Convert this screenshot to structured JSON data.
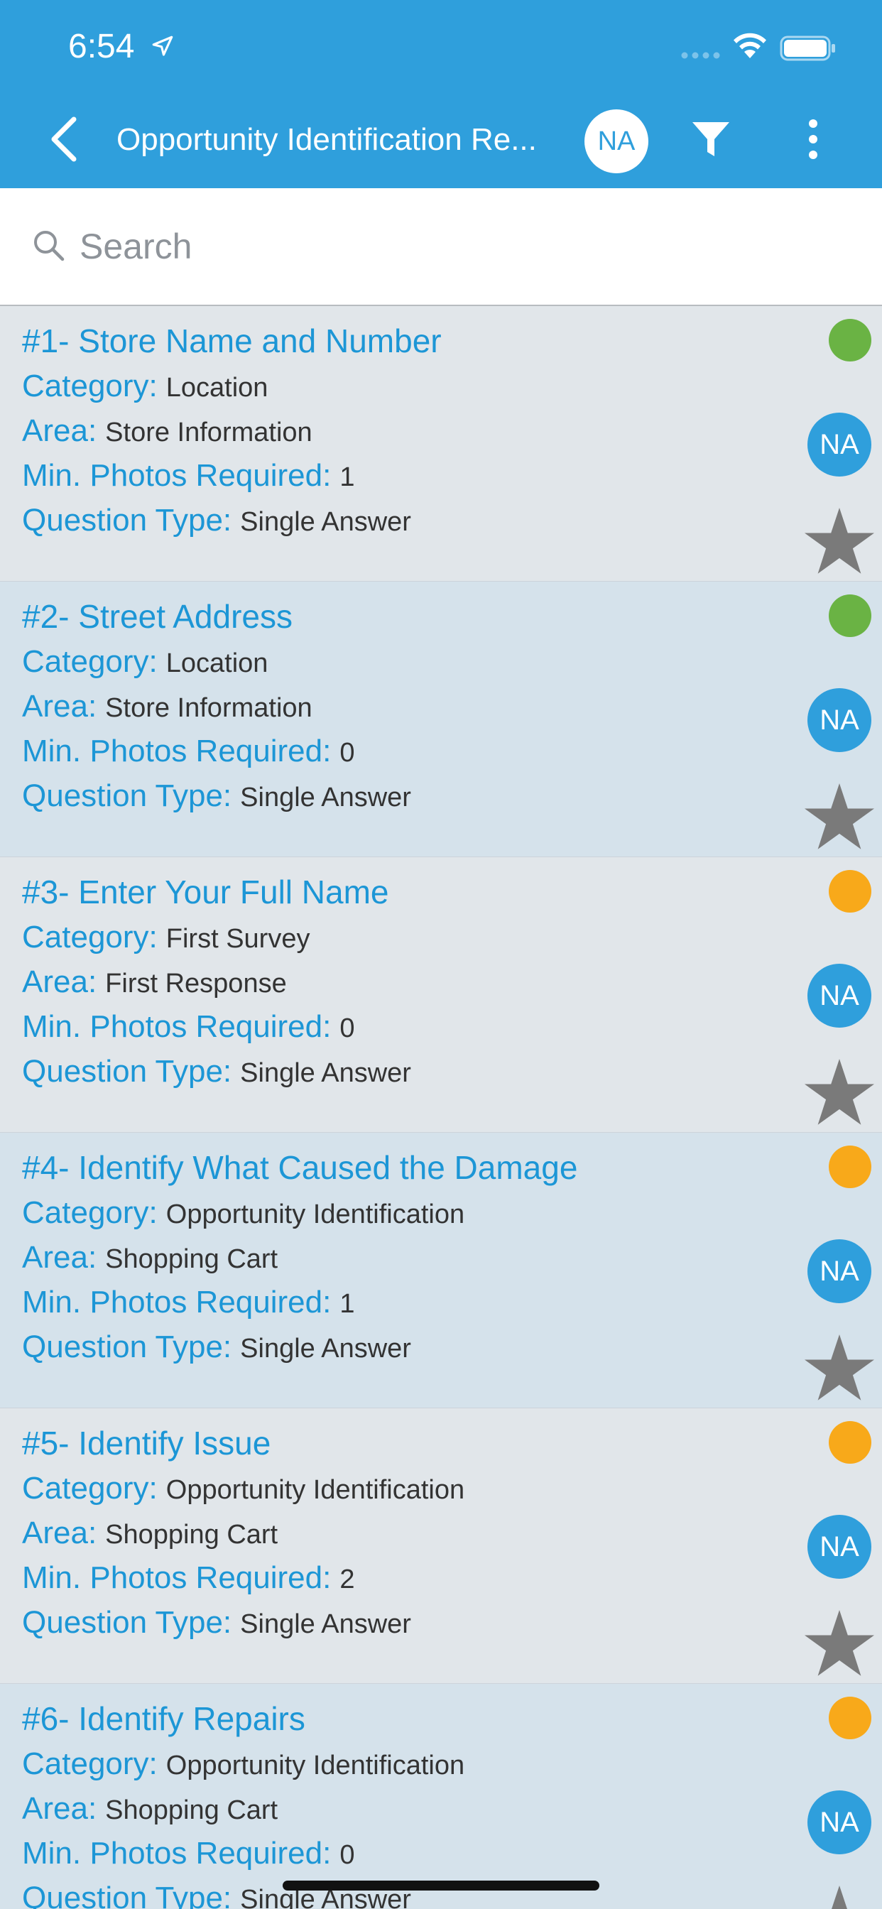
{
  "status_bar": {
    "time": "6:54"
  },
  "header": {
    "title": "Opportunity Identification Re...",
    "avatar_initials": "NA"
  },
  "search": {
    "placeholder": "Search",
    "value": ""
  },
  "colors": {
    "header_bg": "#2f9fdc",
    "accent_text": "#1c96d6",
    "status_green": "#6ab344",
    "status_orange": "#f8a91a",
    "star_gray": "#7a7a7a"
  },
  "labels": {
    "category": "Category:",
    "area": "Area:",
    "min_photos": "Min. Photos Required:",
    "question_type": "Question Type:"
  },
  "questions": [
    {
      "title": "#1- Store Name and Number",
      "category": "Location",
      "area": "Store Information",
      "min_photos": "1",
      "question_type": "Single Answer",
      "status": "green",
      "badge": "NA",
      "star_icon": "star-icon"
    },
    {
      "title": "#2- Street Address",
      "category": "Location",
      "area": "Store Information",
      "min_photos": "0",
      "question_type": "Single Answer",
      "status": "green",
      "badge": "NA",
      "star_icon": "star-icon"
    },
    {
      "title": "#3- Enter Your Full Name",
      "category": "First Survey",
      "area": "First Response",
      "min_photos": "0",
      "question_type": "Single Answer",
      "status": "orange",
      "badge": "NA",
      "star_icon": "star-icon"
    },
    {
      "title": "#4- Identify What Caused the Damage",
      "category": "Opportunity Identification",
      "area": "Shopping Cart",
      "min_photos": "1",
      "question_type": "Single Answer",
      "status": "orange",
      "badge": "NA",
      "star_icon": "star-icon"
    },
    {
      "title": "#5- Identify Issue",
      "category": "Opportunity Identification",
      "area": "Shopping Cart",
      "min_photos": "2",
      "question_type": "Single Answer",
      "status": "orange",
      "badge": "NA",
      "star_icon": "star-icon"
    },
    {
      "title": "#6- Identify Repairs",
      "category": "Opportunity Identification",
      "area": "Shopping Cart",
      "min_photos": "0",
      "question_type": "Single Answer",
      "status": "orange",
      "badge": "NA",
      "star_icon": "star-icon"
    }
  ]
}
